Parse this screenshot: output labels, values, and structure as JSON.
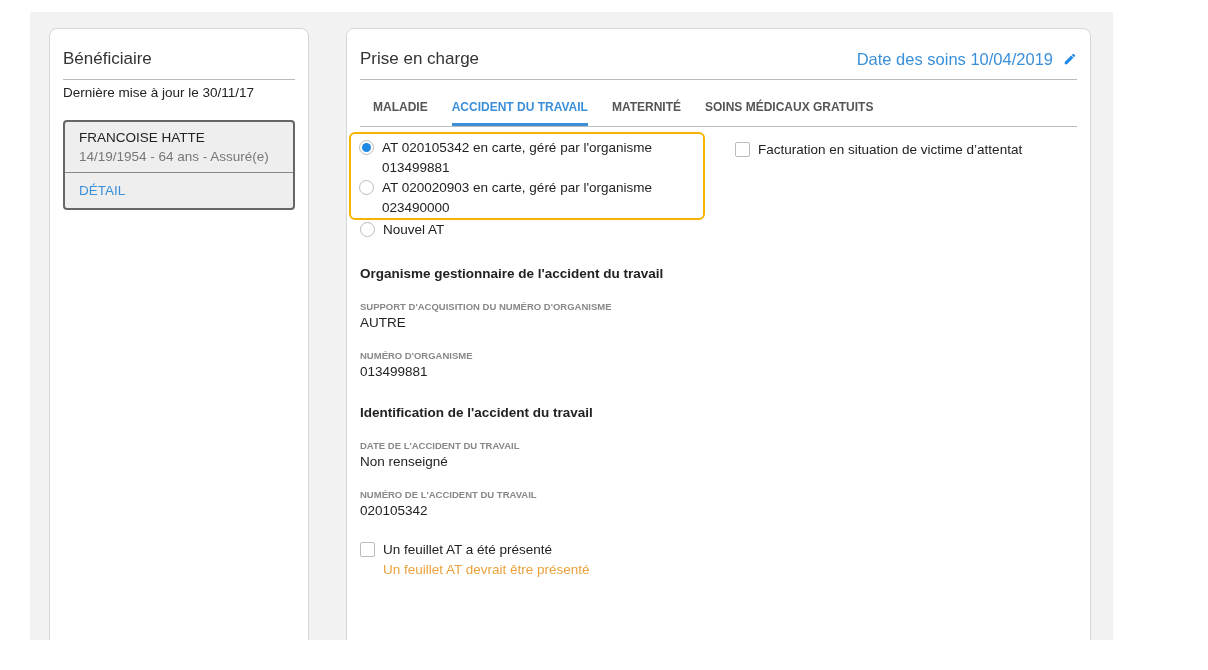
{
  "beneficiary": {
    "title": "Bénéficiaire",
    "updated": "Dernière mise à jour le 30/11/17",
    "patient": {
      "name": "FRANCOISE HATTE",
      "details": "14/19/1954 - 64 ans - Assuré(e)",
      "link": "DÉTAIL"
    }
  },
  "coverage": {
    "title": "Prise en charge",
    "care_date": "Date des soins 10/04/2019",
    "tabs": [
      {
        "label": "MALADIE",
        "selected": false
      },
      {
        "label": "ACCIDENT DU TRAVAIL",
        "selected": true
      },
      {
        "label": "MATERNITÉ",
        "selected": false
      },
      {
        "label": "SOINS MÉDICAUX GRATUITS",
        "selected": false
      }
    ],
    "radios": [
      {
        "label": "AT 020105342 en carte, géré par l'organisme 013499881",
        "selected": true,
        "highlighted": true
      },
      {
        "label": "AT 020020903 en carte, géré par l'organisme 023490000",
        "selected": false,
        "highlighted": true
      },
      {
        "label": "Nouvel AT",
        "selected": false,
        "highlighted": false
      }
    ],
    "attack_checkbox": {
      "label": "Facturation en situation de victime d’attentat",
      "checked": false
    },
    "sections": [
      {
        "title": "Organisme gestionnaire de l'accident du travail",
        "fields": [
          {
            "label": "SUPPORT D'ACQUISITION DU NUMÉRO D'ORGANISME",
            "value": "AUTRE"
          },
          {
            "label": "NUMÉRO D'ORGANISME",
            "value": "013499881"
          }
        ]
      },
      {
        "title": "Identification de l'accident du travail",
        "fields": [
          {
            "label": "DATE DE L'ACCIDENT DU TRAVAIL",
            "value": "Non renseigné"
          },
          {
            "label": "NUMÉRO DE L'ACCIDENT DU TRAVAIL",
            "value": "020105342"
          }
        ]
      }
    ],
    "sheet_checkbox": {
      "label": "Un feuillet AT a été présenté",
      "checked": false,
      "warning": "Un feuillet AT devrait être présenté"
    }
  }
}
